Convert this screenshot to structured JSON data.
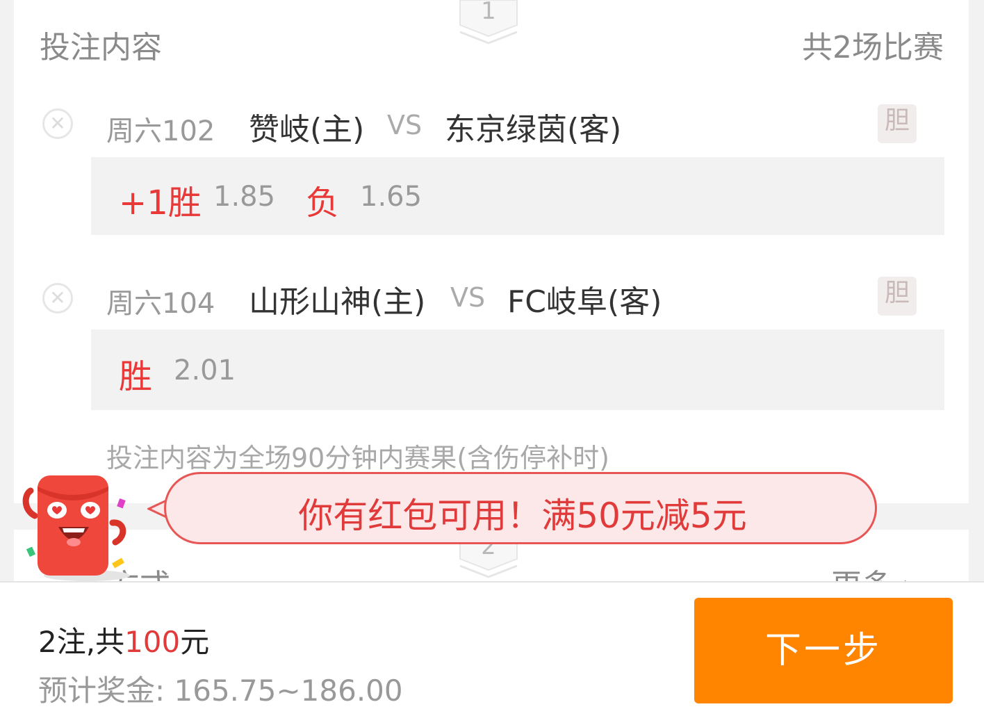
{
  "section1": {
    "step": "1",
    "title": "投注内容",
    "count": "共2场比赛"
  },
  "matches": [
    {
      "code": "周六102",
      "home": "赞岐(主)",
      "vs": "VS",
      "away": "东京绿茵(客)",
      "dan": "胆",
      "picks": [
        {
          "label": "+1胜",
          "odd": "1.85"
        },
        {
          "label": "负",
          "odd": "1.65"
        }
      ]
    },
    {
      "code": "周六104",
      "home": "山形山神(主)",
      "vs": "VS",
      "away": "FC岐阜(客)",
      "dan": "胆",
      "picks": [
        {
          "label": "胜",
          "odd": "2.01"
        }
      ]
    }
  ],
  "note": "投注内容为全场90分钟内赛果(含伤停补时)",
  "section2": {
    "step": "2",
    "title_partial": "方式",
    "more_partial": "更多 ›"
  },
  "promo": {
    "text": "你有红包可用！满50元减5元"
  },
  "footer": {
    "bets": "2注,共",
    "amount": "100",
    "unit": "元",
    "bonus": "预计奖金: 165.75~186.00",
    "next_label": "下一步"
  },
  "colors": {
    "accent": "#e83838",
    "button": "#ff8500"
  },
  "icons": {
    "remove": "close-circle-icon",
    "mascot": "red-envelope-mascot-icon",
    "step": "chevron-badge-icon"
  }
}
